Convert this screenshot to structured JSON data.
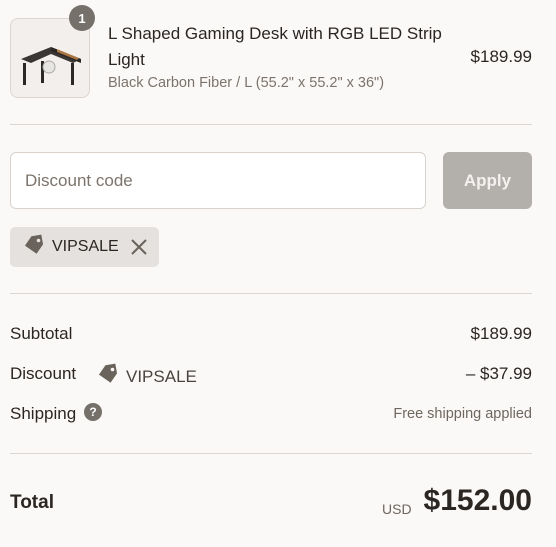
{
  "product": {
    "quantity": "1",
    "title": "L Shaped Gaming Desk with RGB LED Strip Light",
    "variant": "Black Carbon Fiber / L (55.2\" x 55.2\" x 36\")",
    "price": "$189.99",
    "image_icon": "l-shaped-desk-image"
  },
  "discount_form": {
    "placeholder": "Discount code",
    "value": "",
    "apply_label": "Apply"
  },
  "applied_code": {
    "code": "VIPSALE",
    "tag_icon": "tag-icon",
    "remove_icon": "close-icon"
  },
  "summary": {
    "subtotal_label": "Subtotal",
    "subtotal_value": "$189.99",
    "discount_label": "Discount",
    "discount_code": "VIPSALE",
    "discount_value": "– $37.99",
    "shipping_label": "Shipping",
    "shipping_value": "Free shipping applied",
    "help_icon": "question-icon"
  },
  "total": {
    "label": "Total",
    "currency": "USD",
    "amount": "$152.00"
  },
  "colors": {
    "background": "#fbf9f7",
    "apply_disabled": "#b3afab",
    "chip_bg": "#e4e1de",
    "muted_text": "#7c746c"
  }
}
